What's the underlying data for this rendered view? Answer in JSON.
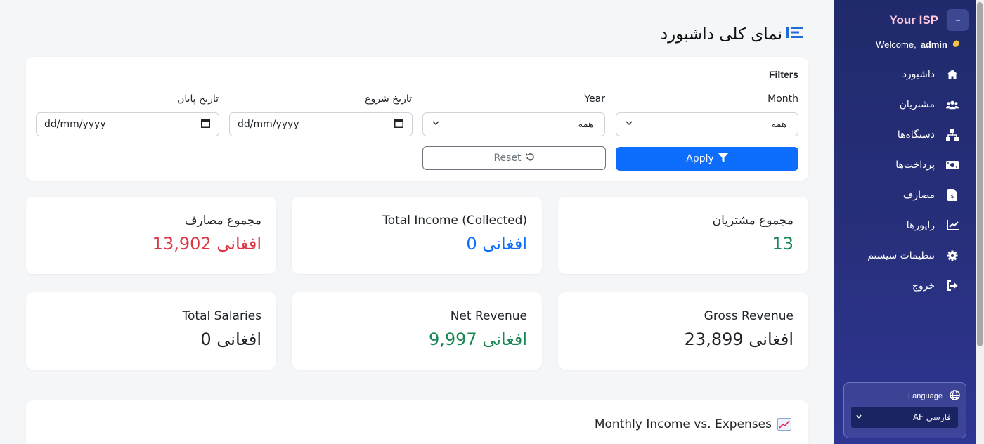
{
  "header": {
    "title": "نمای کلی داشبورد"
  },
  "filters": {
    "title": "Filters",
    "month_label": "Month",
    "year_label": "Year",
    "start_label": "تاریخ شروع",
    "end_label": "تاریخ پایان",
    "month_value": "همه",
    "year_value": "همه",
    "start_placeholder": "dd/mm/yyyy",
    "end_placeholder": "dd/mm/yyyy",
    "apply_label": "Apply",
    "reset_label": "Reset"
  },
  "stats": [
    {
      "label": "مجموع مشتریان",
      "value": "13"
    },
    {
      "label": "Total Income (Collected)",
      "value": "0 افغانی"
    },
    {
      "label": "مجموع مصارف",
      "value": "13,902 افغانی"
    },
    {
      "label": "Gross Revenue",
      "value": "23,899 افغانی"
    },
    {
      "label": "Net Revenue",
      "value": "9,997 افغانی"
    },
    {
      "label": "Total Salaries",
      "value": "0 افغانی"
    }
  ],
  "chart": {
    "title": "Monthly Income vs. Expenses"
  },
  "sidebar": {
    "brand": "Your ISP",
    "welcome_prefix": "Welcome,",
    "user": "admin",
    "items": [
      {
        "label": "داشبورد",
        "icon": "home-icon"
      },
      {
        "label": "مشتریان",
        "icon": "users-icon"
      },
      {
        "label": "دستگاه‌ها",
        "icon": "network-icon"
      },
      {
        "label": "پرداخت‌ها",
        "icon": "money-icon"
      },
      {
        "label": "مصارف",
        "icon": "invoice-icon"
      },
      {
        "label": "راپورها",
        "icon": "chart-line-icon"
      },
      {
        "label": "تنظیمات سیستم",
        "icon": "gear-icon"
      },
      {
        "label": "خروج",
        "icon": "logout-icon"
      }
    ],
    "language_label": "Language",
    "language_value": "AF فارسی"
  },
  "colors": {
    "sidebar": "#272f7a",
    "primary": "#0d6efd",
    "green": "#198754",
    "red": "#dc3545"
  }
}
